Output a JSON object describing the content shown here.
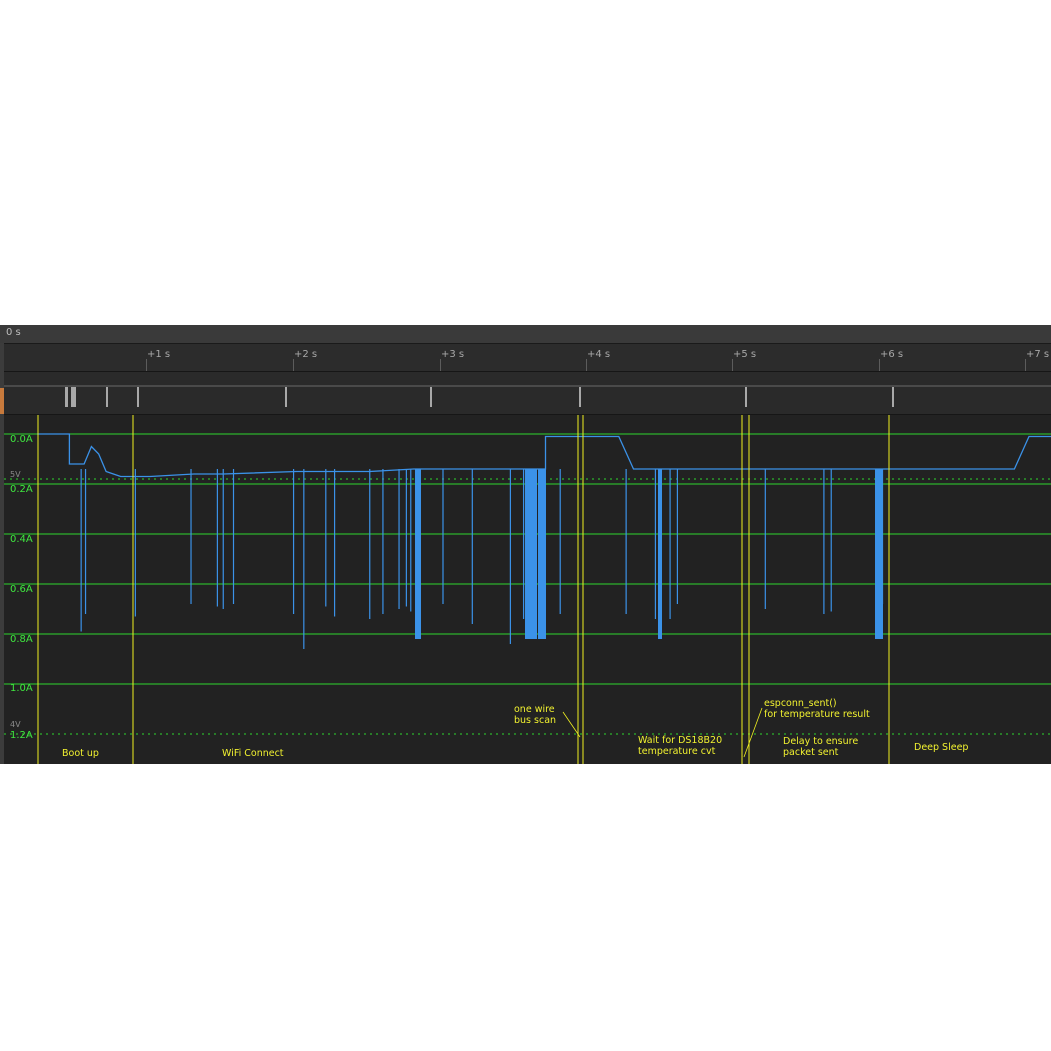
{
  "header": {
    "origin_label": "0 s"
  },
  "ruler": {
    "ticks": [
      "+1 s",
      "+2 s",
      "+3 s",
      "+4 s",
      "+5 s",
      "+6 s",
      "+7 s"
    ]
  },
  "axis": {
    "y_labels": [
      "0.0A",
      "0.2A",
      "0.4A",
      "0.6A",
      "0.8A",
      "1.0A",
      "1.2A"
    ],
    "ref_labels": [
      "5V",
      "4V"
    ]
  },
  "annotations": {
    "boot_up": "Boot up",
    "wifi_connect": "WiFi Connect",
    "one_wire_1": "one wire",
    "one_wire_2": "bus scan",
    "wait_1": "Wait for DS18B20",
    "wait_2": "temperature cvt",
    "espconn_1": "espconn_sent()",
    "espconn_2": "for temperature result",
    "delay_1": "Delay to ensure",
    "delay_2": "packet sent",
    "deep_sleep": "Deep Sleep"
  },
  "colors": {
    "background": "#222222",
    "grid": "#2fd62f",
    "signal": "#3b92e8",
    "marker": "#f0f020",
    "digital_pulse": "#a0a0a0"
  },
  "chart_data": {
    "type": "line",
    "title": "",
    "xlabel": "",
    "ylabel": "",
    "x_unit": "s",
    "y_unit": "A",
    "xlim": [
      -0.77,
      6.35
    ],
    "ylim": [
      1.2,
      0.0
    ],
    "grid": true,
    "series": [
      {
        "x": [
          -0.77,
          -0.55,
          -0.55,
          -0.45,
          -0.4,
          -0.35,
          -0.3,
          -0.25,
          -0.2,
          0.0,
          0.3,
          0.5,
          1.0,
          1.5,
          1.8,
          2.0,
          2.3,
          2.5,
          2.7,
          2.7,
          3.0,
          3.2,
          3.3,
          3.5,
          3.7,
          3.9,
          4.0,
          4.5,
          4.7,
          5.0,
          5.2,
          5.8,
          5.9,
          6.0,
          6.35
        ],
        "y": [
          0.0,
          0.0,
          0.12,
          0.12,
          0.05,
          0.08,
          0.15,
          0.16,
          0.17,
          0.17,
          0.16,
          0.16,
          0.15,
          0.15,
          0.14,
          0.14,
          0.14,
          0.14,
          0.14,
          0.01,
          0.01,
          0.01,
          0.14,
          0.14,
          0.14,
          0.14,
          0.14,
          0.14,
          0.14,
          0.14,
          0.14,
          0.14,
          0.14,
          0.01,
          0.01
        ]
      },
      {
        "name": "spikes",
        "x": [
          -0.47,
          -0.44,
          -0.1,
          0.28,
          0.46,
          0.5,
          0.57,
          0.98,
          1.05,
          1.2,
          1.26,
          1.5,
          1.59,
          1.7,
          1.75,
          1.78,
          2.0,
          2.2,
          2.46,
          2.55,
          2.8,
          3.25,
          3.45,
          3.55,
          3.6,
          4.2,
          4.6,
          4.65,
          5.0
        ],
        "y": [
          0.79,
          0.72,
          0.73,
          0.68,
          0.69,
          0.7,
          0.68,
          0.72,
          0.86,
          0.69,
          0.73,
          0.74,
          0.72,
          0.7,
          0.69,
          0.71,
          0.68,
          0.76,
          0.84,
          0.74,
          0.72,
          0.72,
          0.74,
          0.74,
          0.68,
          0.7,
          0.72,
          0.71,
          0.68
        ]
      }
    ]
  }
}
